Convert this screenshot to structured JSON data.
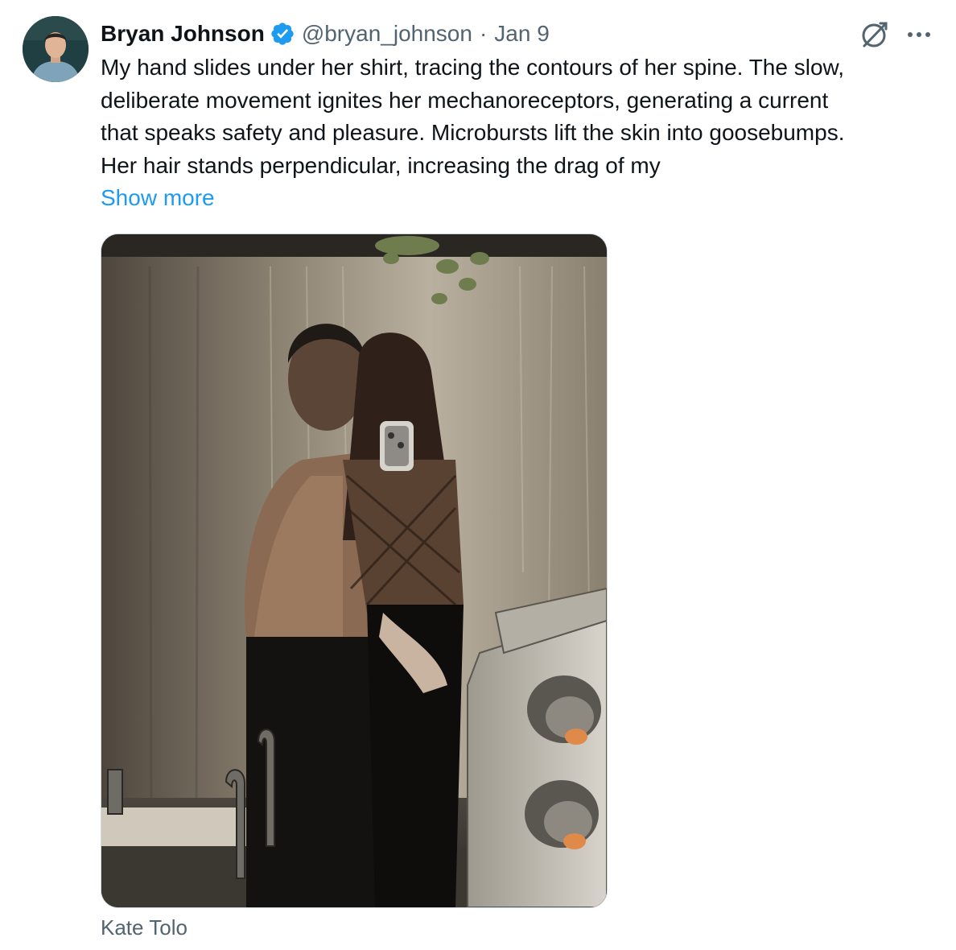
{
  "author": {
    "name": "Bryan Johnson",
    "handle": "@bryan_johnson",
    "separator": "·",
    "date": "Jan 9",
    "verified": true,
    "verified_color": "#1d9bf0"
  },
  "tweet": {
    "text_lines": [
      "My hand slides under her shirt, tracing the contours of her spine. The slow,",
      "deliberate movement ignites her mechanoreceptors, generating a current",
      "that speaks safety and pleasure. Microbursts lift the skin into goosebumps.",
      "Her hair stands perpendicular, increasing the drag of my"
    ],
    "show_more_label": "Show more",
    "show_more_color": "#1d9bf0"
  },
  "media": {
    "caption": "Kate Tolo"
  },
  "icons": {
    "avatar": "avatar",
    "verified": "verified-badge-icon",
    "grok": "grok-icon",
    "more": "more-options-icon"
  }
}
